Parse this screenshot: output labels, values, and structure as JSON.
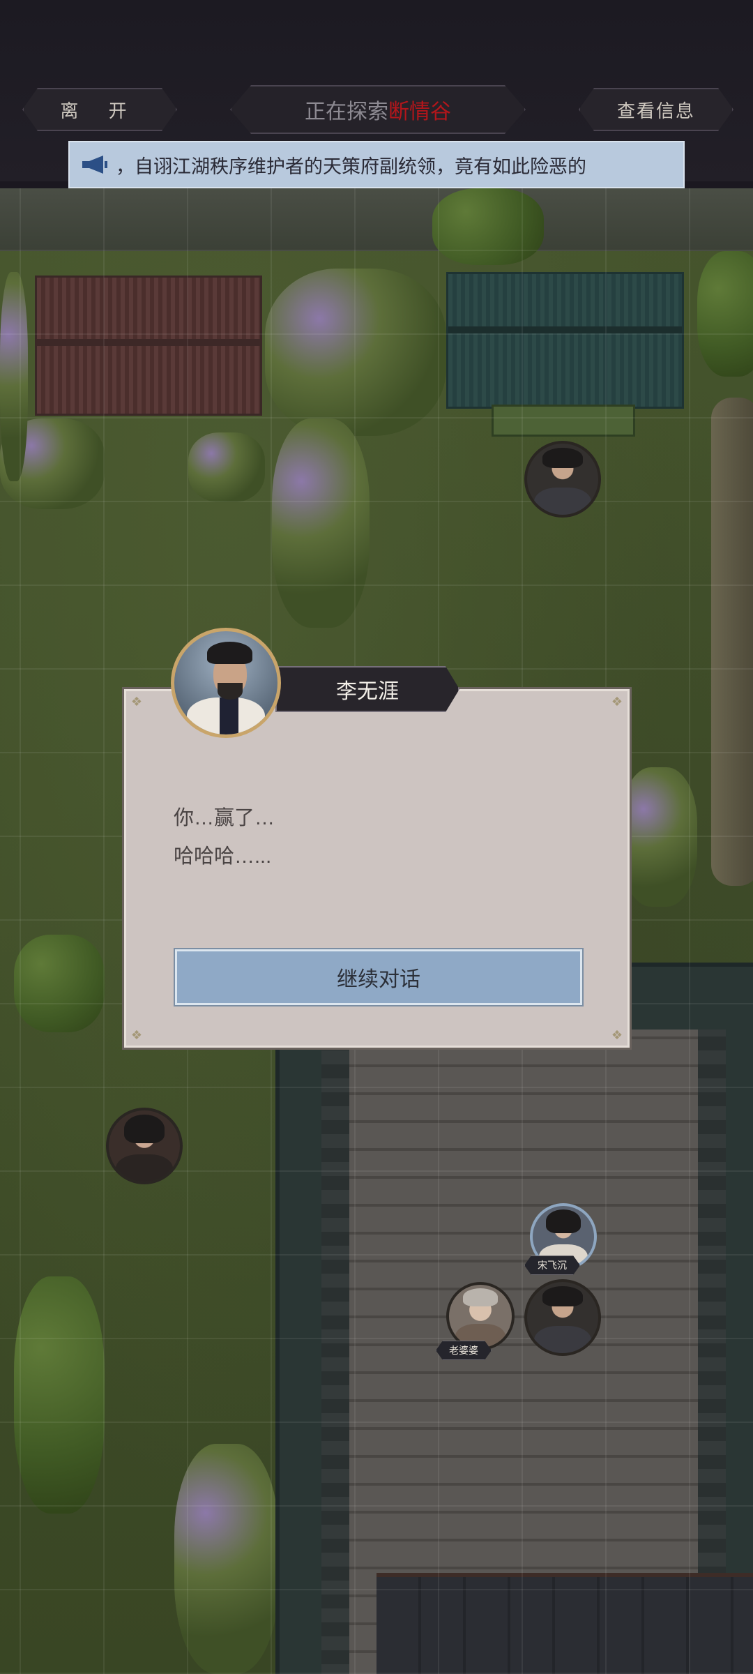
{
  "header": {
    "leave_label": "离 开",
    "exploring_prefix": "正在探索",
    "location_name": "断情谷",
    "info_label": "查看信息"
  },
  "marquee": {
    "icon": "megaphone-icon",
    "text": "，自诩江湖秩序维护者的天策府副统领，竟有如此险恶的"
  },
  "map": {
    "characters": [
      {
        "id": "warrior-top"
      },
      {
        "id": "woman-left"
      },
      {
        "id": "song-feiyan",
        "label": "宋飞沉"
      },
      {
        "id": "old-woman",
        "label": "老婆婆"
      },
      {
        "id": "warrior-courtyard"
      }
    ]
  },
  "dialog": {
    "speaker": "李无涯",
    "lines": [
      "你…赢了…",
      "哈哈哈…..."
    ],
    "continue_label": "继续对话"
  }
}
